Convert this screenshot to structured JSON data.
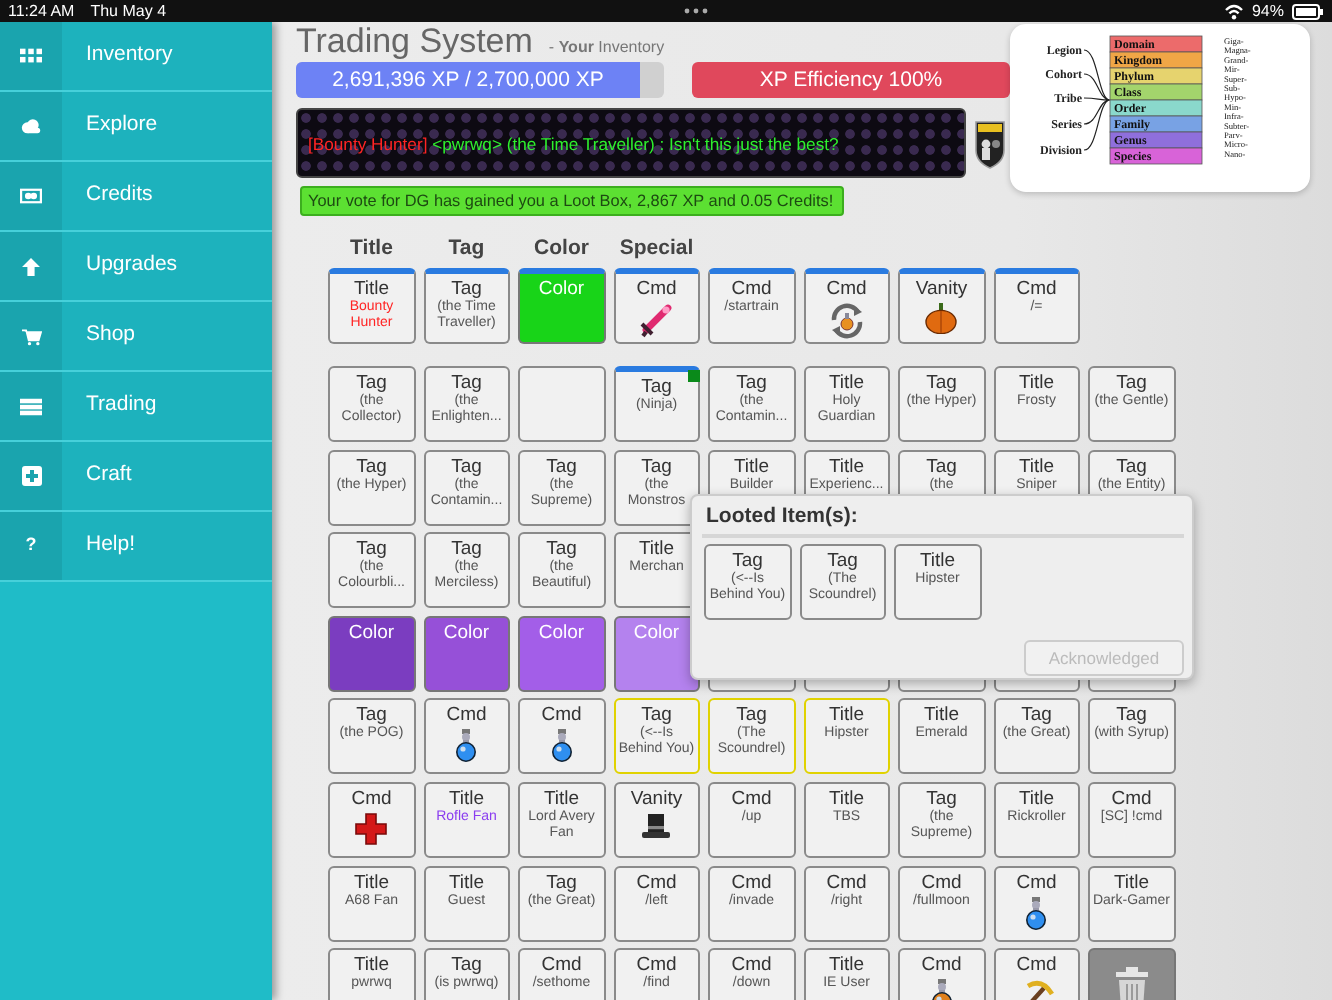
{
  "status_bar": {
    "time": "11:24 AM",
    "date": "Thu May 4",
    "battery": "94%"
  },
  "sidebar": {
    "items": [
      {
        "label": "Inventory"
      },
      {
        "label": "Explore"
      },
      {
        "label": "Credits"
      },
      {
        "label": "Upgrades"
      },
      {
        "label": "Shop"
      },
      {
        "label": "Trading"
      },
      {
        "label": "Craft"
      },
      {
        "label": "Help!",
        "icon": "?"
      }
    ]
  },
  "header": {
    "title": "Trading System",
    "subtitle": "- **Your** Inventory"
  },
  "xp_bar": {
    "text": "2,691,396 XP / 2,700,000 XP",
    "level": 0.935
  },
  "efficiency": {
    "text": "XP Efficiency 100%"
  },
  "banner": {
    "segments": [
      {
        "text": "[Bounty Hunter]",
        "color": "#ff2424"
      },
      {
        "text": " <pwrwq> (the Time Traveller) : Isn't this just the best?",
        "color": "#2ef02e"
      }
    ]
  },
  "notification": "Your vote for DG has gained you a Loot Box, 2,867 XP and 0.05 Credits!",
  "taxonomy": {
    "groups": [
      "Legion",
      "Cohort",
      "Tribe",
      "Series",
      "Division"
    ],
    "ranks": [
      {
        "name": "Domain",
        "color": "#ec6b6b"
      },
      {
        "name": "Kingdom",
        "color": "#f0a646"
      },
      {
        "name": "Phylum",
        "color": "#e6d36e"
      },
      {
        "name": "Class",
        "color": "#a3d46c"
      },
      {
        "name": "Order",
        "color": "#8ad8cc"
      },
      {
        "name": "Family",
        "color": "#78a2e4"
      },
      {
        "name": "Genus",
        "color": "#8f6fdc"
      },
      {
        "name": "Species",
        "color": "#d863d8"
      }
    ],
    "prefixes": [
      "Giga-",
      "Magna-",
      "Grand-",
      "Mir-",
      "Super-",
      "Sub-",
      "Hypo-",
      "Min-",
      "Infra-",
      "Subter-",
      "Parv-",
      "Micro-",
      "Nano-"
    ]
  },
  "equipped": {
    "columns": [
      "Title",
      "Tag",
      "Color",
      "Special"
    ],
    "slots": [
      {
        "kind": "text",
        "type": "Title",
        "name": "Bounty Hunter",
        "color": "#ff2424",
        "equipped": true,
        "new": false,
        "flagged": false
      },
      {
        "kind": "text",
        "type": "Tag",
        "name": "(the Time Traveller)",
        "equipped": true,
        "new": false,
        "flagged": false
      },
      {
        "kind": "swatch",
        "label": "Color",
        "color": "#18d418",
        "equipped": true,
        "new": false,
        "flagged": false
      },
      {
        "kind": "sword",
        "type": "Cmd",
        "equipped": true,
        "new": false,
        "flagged": false
      },
      {
        "kind": "text",
        "type": "Cmd",
        "name": "/startrain",
        "equipped": true,
        "new": false,
        "flagged": false
      },
      {
        "kind": "recycle",
        "type": "Cmd",
        "equipped": true,
        "new": false,
        "flagged": false
      },
      {
        "kind": "pumpkin",
        "type": "Vanity",
        "equipped": true,
        "new": false,
        "flagged": false
      },
      {
        "kind": "text",
        "type": "Cmd",
        "name": "/=",
        "equipped": true,
        "new": false,
        "flagged": false
      }
    ]
  },
  "inventory": {
    "rows": [
      [
        {
          "kind": "text",
          "type": "Tag",
          "name": "(the Collector)",
          "equipped": false,
          "new": false,
          "flagged": false
        },
        {
          "kind": "text",
          "type": "Tag",
          "name": "(the Enlighten...",
          "equipped": false,
          "new": false,
          "flagged": false
        },
        {
          "kind": "empty"
        },
        {
          "kind": "text",
          "type": "Tag",
          "name": "(Ninja)",
          "equipped": true,
          "new": false,
          "flagged": true
        },
        {
          "kind": "text",
          "type": "Tag",
          "name": "(the Contamin...",
          "equipped": false,
          "new": false,
          "flagged": false
        },
        {
          "kind": "text",
          "type": "Title",
          "name": "Holy Guardian",
          "equipped": false,
          "new": false,
          "flagged": false
        },
        {
          "kind": "text",
          "type": "Tag",
          "name": "(the Hyper)",
          "equipped": false,
          "new": false,
          "flagged": false
        },
        {
          "kind": "text",
          "type": "Title",
          "name": "Frosty",
          "equipped": false,
          "new": false,
          "flagged": false
        },
        {
          "kind": "text",
          "type": "Tag",
          "name": "(the Gentle)",
          "equipped": false,
          "new": false,
          "flagged": false
        }
      ],
      [
        {
          "kind": "text",
          "type": "Tag",
          "name": "(the Hyper)",
          "equipped": false,
          "new": false,
          "flagged": false
        },
        {
          "kind": "text",
          "type": "Tag",
          "name": "(the Contamin...",
          "equipped": false,
          "new": false,
          "flagged": false
        },
        {
          "kind": "text",
          "type": "Tag",
          "name": "(the Supreme)",
          "equipped": false,
          "new": false,
          "flagged": false
        },
        {
          "kind": "text",
          "type": "Tag",
          "name": "(the Monstros",
          "equipped": false,
          "new": false,
          "flagged": false
        },
        {
          "kind": "text",
          "type": "Title",
          "name": "Builder",
          "equipped": false,
          "new": false,
          "flagged": false
        },
        {
          "kind": "text",
          "type": "Title",
          "name": "Experienc...",
          "equipped": false,
          "new": false,
          "flagged": false
        },
        {
          "kind": "text",
          "type": "Tag",
          "name": "(the",
          "equipped": false,
          "new": false,
          "flagged": false
        },
        {
          "kind": "text",
          "type": "Title",
          "name": "Sniper",
          "equipped": false,
          "new": false,
          "flagged": false
        },
        {
          "kind": "text",
          "type": "Tag",
          "name": "(the Entity)",
          "equipped": false,
          "new": false,
          "flagged": false
        }
      ],
      [
        {
          "kind": "text",
          "type": "Tag",
          "name": "(the Colourbli...",
          "equipped": false,
          "new": false,
          "flagged": false
        },
        {
          "kind": "text",
          "type": "Tag",
          "name": "(the Merciless)",
          "equipped": false,
          "new": false,
          "flagged": false
        },
        {
          "kind": "text",
          "type": "Tag",
          "name": "(the Beautiful)",
          "equipped": false,
          "new": false,
          "flagged": false
        },
        {
          "kind": "text",
          "type": "Title",
          "name": "Merchan",
          "equipped": false,
          "new": false,
          "flagged": false
        }
      ],
      [
        {
          "kind": "swatch",
          "label": "Color",
          "color": "#7b3dc0",
          "equipped": false,
          "new": false,
          "flagged": false
        },
        {
          "kind": "swatch",
          "label": "Color",
          "color": "#9650d8",
          "equipped": false,
          "new": false,
          "flagged": false
        },
        {
          "kind": "swatch",
          "label": "Color",
          "color": "#a35ee8",
          "equipped": false,
          "new": false,
          "flagged": false
        },
        {
          "kind": "swatch",
          "label": "Color",
          "color": "#b482ee",
          "equipped": false,
          "new": false,
          "flagged": false
        },
        {
          "kind": "empty"
        },
        {
          "kind": "empty"
        },
        {
          "kind": "empty"
        },
        {
          "kind": "empty"
        },
        {
          "kind": "empty"
        }
      ],
      [
        {
          "kind": "text",
          "type": "Tag",
          "name": "(the POG)",
          "equipped": false,
          "new": false,
          "flagged": false
        },
        {
          "kind": "potion",
          "type": "Cmd",
          "color": "#2f8ff0",
          "equipped": false,
          "new": false,
          "flagged": false
        },
        {
          "kind": "potion",
          "type": "Cmd",
          "color": "#2f8ff0",
          "equipped": false,
          "new": false,
          "flagged": false
        },
        {
          "kind": "text",
          "type": "Tag",
          "name": "(<--Is Behind You)",
          "equipped": false,
          "new": true,
          "flagged": false
        },
        {
          "kind": "text",
          "type": "Tag",
          "name": "(The Scoundrel)",
          "equipped": false,
          "new": true,
          "flagged": false
        },
        {
          "kind": "text",
          "type": "Title",
          "name": "Hipster",
          "equipped": false,
          "new": true,
          "flagged": false
        },
        {
          "kind": "text",
          "type": "Title",
          "name": "Emerald",
          "equipped": false,
          "new": false,
          "flagged": false
        },
        {
          "kind": "text",
          "type": "Tag",
          "name": "(the Great)",
          "equipped": false,
          "new": false,
          "flagged": false
        },
        {
          "kind": "text",
          "type": "Tag",
          "name": "(with Syrup)",
          "equipped": false,
          "new": false,
          "flagged": false
        }
      ],
      [
        {
          "kind": "cross",
          "type": "Cmd",
          "equipped": false,
          "new": false,
          "flagged": false
        },
        {
          "kind": "text",
          "type": "Title",
          "name": "Rofle Fan",
          "color": "#8a3cf0",
          "equipped": false,
          "new": false,
          "flagged": false
        },
        {
          "kind": "text",
          "type": "Title",
          "name": "Lord Avery Fan",
          "equipped": false,
          "new": false,
          "flagged": false
        },
        {
          "kind": "hat",
          "type": "Vanity",
          "equipped": false,
          "new": false,
          "flagged": false
        },
        {
          "kind": "text",
          "type": "Cmd",
          "name": "/up",
          "equipped": false,
          "new": false,
          "flagged": false
        },
        {
          "kind": "text",
          "type": "Title",
          "name": "TBS",
          "equipped": false,
          "new": false,
          "flagged": false
        },
        {
          "kind": "text",
          "type": "Tag",
          "name": "(the Supreme)",
          "equipped": false,
          "new": false,
          "flagged": false
        },
        {
          "kind": "text",
          "type": "Title",
          "name": "Rickroller",
          "equipped": false,
          "new": false,
          "flagged": false
        },
        {
          "kind": "text",
          "type": "Cmd",
          "name": "[SC] !cmd",
          "equipped": false,
          "new": false,
          "flagged": false
        }
      ],
      [
        {
          "kind": "text",
          "type": "Title",
          "name": "A68 Fan",
          "equipped": false,
          "new": false,
          "flagged": false
        },
        {
          "kind": "text",
          "type": "Title",
          "name": "Guest",
          "equipped": false,
          "new": false,
          "flagged": false
        },
        {
          "kind": "text",
          "type": "Tag",
          "name": "(the Great)",
          "equipped": false,
          "new": false,
          "flagged": false
        },
        {
          "kind": "text",
          "type": "Cmd",
          "name": "/left",
          "equipped": false,
          "new": false,
          "flagged": false
        },
        {
          "kind": "text",
          "type": "Cmd",
          "name": "/invade",
          "equipped": false,
          "new": false,
          "flagged": false
        },
        {
          "kind": "text",
          "type": "Cmd",
          "name": "/right",
          "equipped": false,
          "new": false,
          "flagged": false
        },
        {
          "kind": "text",
          "type": "Cmd",
          "name": "/fullmoon",
          "equipped": false,
          "new": false,
          "flagged": false
        },
        {
          "kind": "potion",
          "type": "Cmd",
          "color": "#2f8ff0",
          "equipped": false,
          "new": false,
          "flagged": false
        },
        {
          "kind": "text",
          "type": "Title",
          "name": "Dark-Gamer",
          "equipped": false,
          "new": false,
          "flagged": false
        }
      ],
      [
        {
          "kind": "text",
          "type": "Title",
          "name": "pwrwq",
          "equipped": false,
          "new": false,
          "flagged": false
        },
        {
          "kind": "text",
          "type": "Tag",
          "name": "(is pwrwq)",
          "equipped": false,
          "new": false,
          "flagged": false
        },
        {
          "kind": "text",
          "type": "Cmd",
          "name": "/sethome",
          "equipped": false,
          "new": false,
          "flagged": false
        },
        {
          "kind": "text",
          "type": "Cmd",
          "name": "/find",
          "equipped": false,
          "new": false,
          "flagged": false
        },
        {
          "kind": "text",
          "type": "Cmd",
          "name": "/down",
          "equipped": false,
          "new": false,
          "flagged": false
        },
        {
          "kind": "text",
          "type": "Title",
          "name": "IE User",
          "equipped": false,
          "new": false,
          "flagged": false
        },
        {
          "kind": "potion",
          "type": "Cmd",
          "color": "#e0801c",
          "equipped": false,
          "new": false,
          "flagged": false
        },
        {
          "kind": "pickaxe",
          "type": "Cmd",
          "equipped": false,
          "new": false,
          "flagged": false
        },
        {
          "kind": "trash"
        }
      ]
    ]
  },
  "popup": {
    "title": "Looted Item(s):",
    "items": [
      {
        "kind": "text",
        "type": "Tag",
        "name": "(<--Is Behind You)",
        "equipped": false,
        "new": false,
        "flagged": false
      },
      {
        "kind": "text",
        "type": "Tag",
        "name": "(The Scoundrel)",
        "equipped": false,
        "new": false,
        "flagged": false
      },
      {
        "kind": "text",
        "type": "Title",
        "name": "Hipster",
        "equipped": false,
        "new": false,
        "flagged": false
      }
    ],
    "button": {
      "label": "Acknowledged",
      "disabled": true
    }
  }
}
